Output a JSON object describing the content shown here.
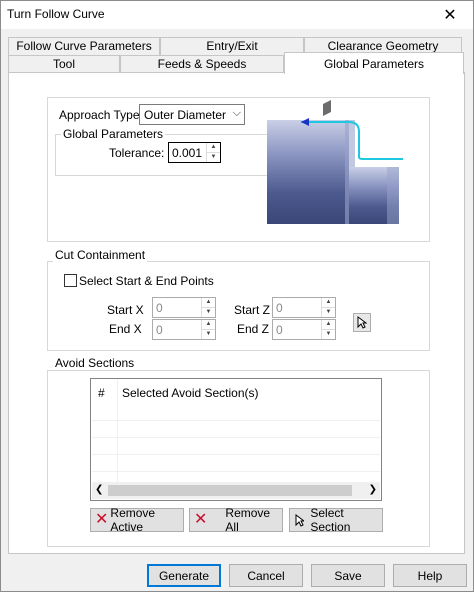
{
  "window": {
    "title": "Turn Follow Curve",
    "close_glyph": "✕"
  },
  "tabs_row1": [
    "Follow Curve Parameters",
    "Entry/Exit",
    "Clearance Geometry"
  ],
  "tabs_row2": [
    "Tool",
    "Feeds & Speeds",
    "Global Parameters"
  ],
  "approach": {
    "label": "Approach Type",
    "value": "Outer Diameter"
  },
  "global_params": {
    "label": "Global Parameters",
    "tolerance_label": "Tolerance:",
    "tolerance_value": "0.001"
  },
  "cut_containment": {
    "label": "Cut Containment",
    "checkbox_label": "Select Start & End Points",
    "start_x_label": "Start X",
    "start_x_value": "0",
    "end_x_label": "End X",
    "end_x_value": "0",
    "start_z_label": "Start Z",
    "start_z_value": "0",
    "end_z_label": "End Z",
    "end_z_value": "0"
  },
  "avoid_sections": {
    "label": "Avoid Sections",
    "col_num": "#",
    "col_name": "Selected Avoid Section(s)",
    "remove_active": "Remove Active",
    "remove_all": "Remove All",
    "select_section": "Select Section"
  },
  "footer": {
    "generate": "Generate",
    "cancel": "Cancel",
    "save": "Save",
    "help": "Help"
  },
  "colors": {
    "accent": "#0078d7",
    "toolpath": "#1ec8e0",
    "arrow": "#1a33c8",
    "part": "#5c6a9e",
    "remove_x": "#c8102e"
  }
}
